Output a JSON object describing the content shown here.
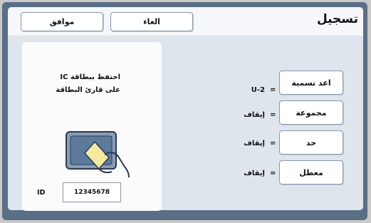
{
  "header": {
    "title": "تسجيل",
    "ok_label": "موافق",
    "cancel_label": "الغاء"
  },
  "card": {
    "message_line1": "احتفظ ببطاقة IC",
    "message_line2": "على قارئ البطاقة",
    "id_label": "ID",
    "id_value": "12345678"
  },
  "settings": [
    {
      "button": "اعد تسمية",
      "equals": "=",
      "value": "U-2"
    },
    {
      "button": "مجموعة",
      "equals": "=",
      "value": "إيقاف"
    },
    {
      "button": "حد",
      "equals": "=",
      "value": "إيقاف"
    },
    {
      "button": "معطل",
      "equals": "=",
      "value": "إيقاف"
    }
  ],
  "colors": {
    "frame": "#5a6f86",
    "content_bg": "#dfe5ed",
    "card_illustration": "#4a6a9a",
    "card_hand_yellow": "#f3e9a0"
  }
}
